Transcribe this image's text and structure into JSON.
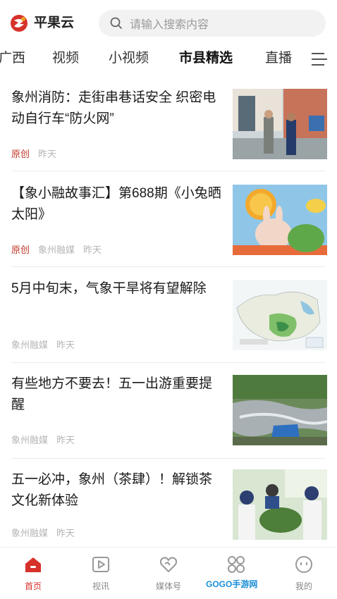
{
  "header": {
    "brand": "平果云",
    "search_placeholder": "请输入搜索内容"
  },
  "tabs": [
    {
      "label": "广西"
    },
    {
      "label": "视频"
    },
    {
      "label": "小视频"
    },
    {
      "label": "市县精选",
      "active": true
    },
    {
      "label": "直播"
    }
  ],
  "news": [
    {
      "title": "象州消防：走街串巷话安全 织密电动自行车“防火网”",
      "original": "原创",
      "source": "",
      "time": "昨天"
    },
    {
      "title": "【象小融故事汇】第688期《小兔晒太阳》",
      "original": "原创",
      "source": "象州融媒",
      "time": "昨天"
    },
    {
      "title": "5月中旬末，气象干旱将有望解除",
      "original": "",
      "source": "象州融媒",
      "time": "昨天"
    },
    {
      "title": "有些地方不要去！五一出游重要提醒",
      "original": "",
      "source": "象州融媒",
      "time": "昨天"
    },
    {
      "title": "五一必冲，象州（茶肆）！解锁茶文化新体验",
      "original": "",
      "source": "象州融媒",
      "time": "昨天"
    }
  ],
  "bottom_nav": [
    {
      "label": "首页",
      "icon": "home-icon",
      "active": true
    },
    {
      "label": "视讯",
      "icon": "video-icon"
    },
    {
      "label": "媒体号",
      "icon": "heart-icon"
    },
    {
      "label": "",
      "icon": "services-icon"
    },
    {
      "label": "我的",
      "icon": "profile-icon"
    }
  ],
  "watermark": "GOGO手游网",
  "colors": {
    "accent": "#d6322b",
    "original_tag": "#c0392b",
    "meta": "#b5b5b5"
  }
}
